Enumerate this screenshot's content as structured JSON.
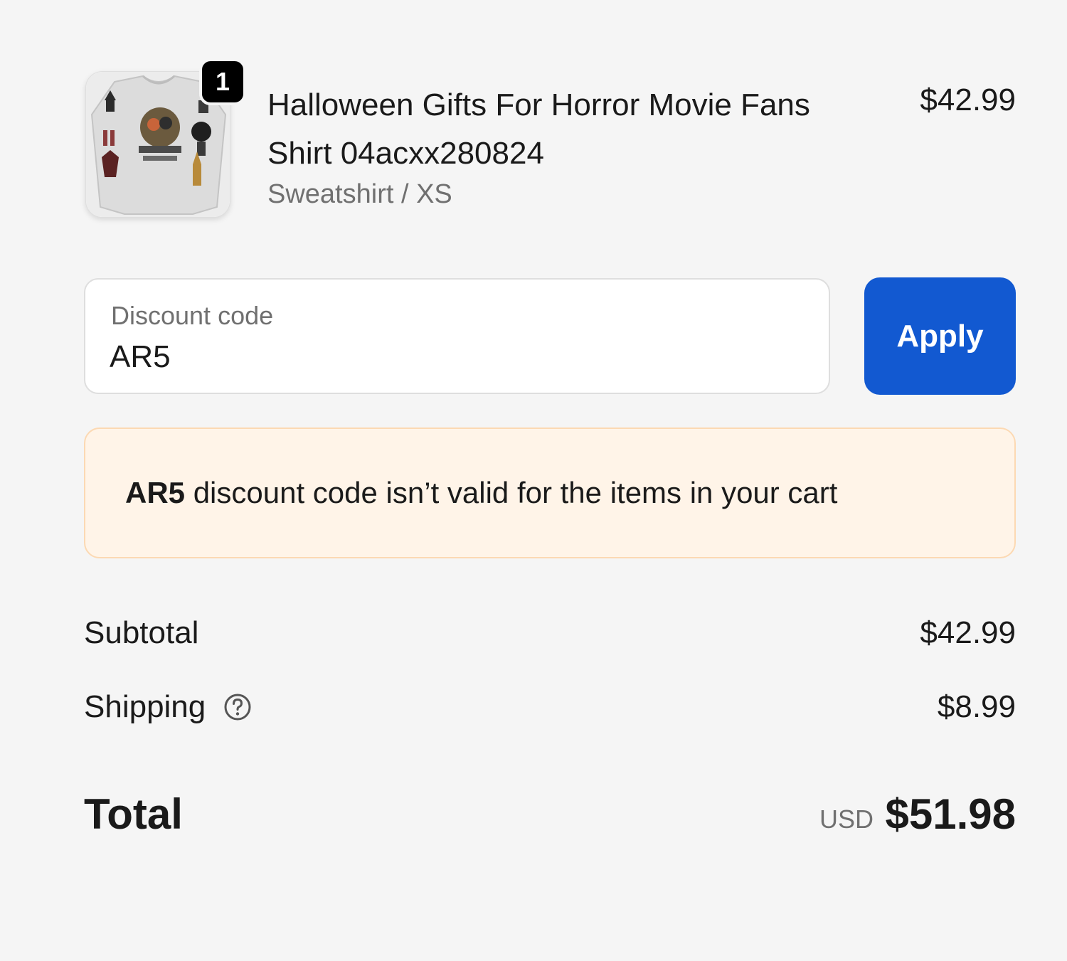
{
  "line_item": {
    "quantity": "1",
    "title": "Halloween Gifts For Horror Movie Fans Shirt 04acxx280824",
    "variant": "Sweatshirt / XS",
    "price": "$42.99",
    "thumbnail_icon": "product-thumbnail-sweatshirt"
  },
  "discount": {
    "label": "Discount code",
    "value": "AR5",
    "apply_label": "Apply"
  },
  "notice": {
    "code": "AR5",
    "message": " discount code isn’t valid for the items in your cart"
  },
  "totals": {
    "subtotal_label": "Subtotal",
    "subtotal_value": "$42.99",
    "shipping_label": "Shipping",
    "shipping_value": "$8.99",
    "total_label": "Total",
    "currency": "USD",
    "total_value": "$51.98"
  },
  "colors": {
    "background": "#f5f5f5",
    "accent": "#1259d1",
    "notice_bg": "#fff4e8",
    "notice_border": "#fcd9b3"
  }
}
